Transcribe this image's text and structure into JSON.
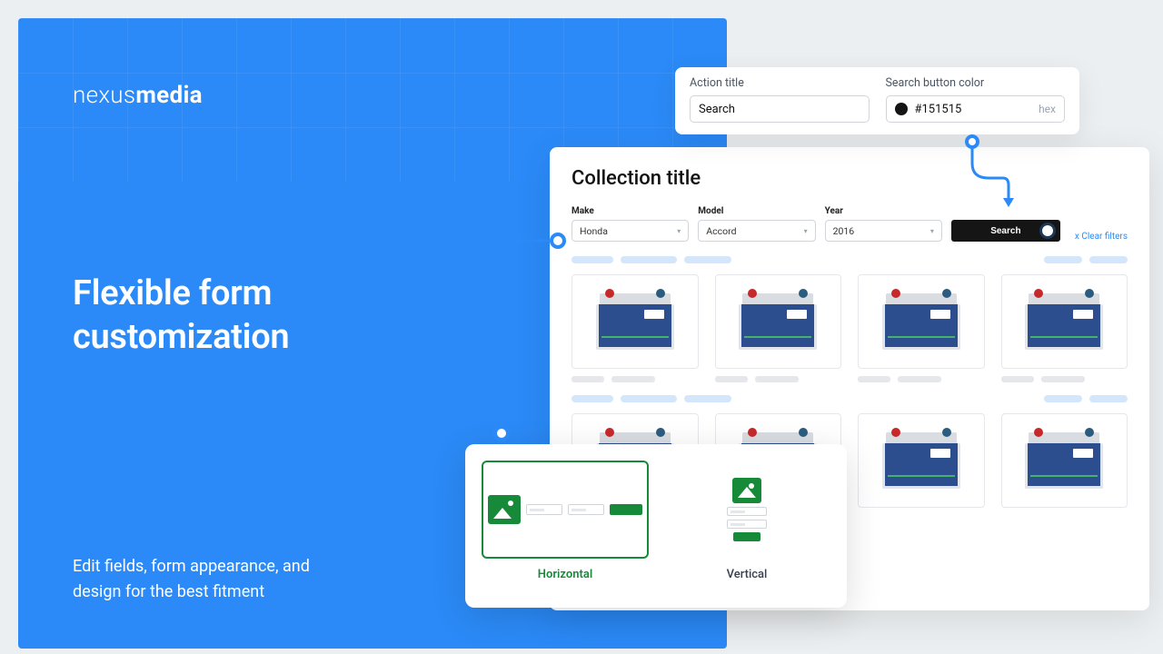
{
  "brand": {
    "part1": "nexus",
    "part2": "media"
  },
  "hero": {
    "headline_l1": "Flexible form",
    "headline_l2": "customization",
    "subcopy": "Edit fields, form appearance, and design for the best fitment"
  },
  "settings": {
    "action_label": "Action title",
    "action_value": "Search",
    "color_label": "Search button color",
    "color_value": "#151515",
    "color_format": "hex"
  },
  "collection": {
    "title": "Collection title",
    "filters": {
      "make_label": "Make",
      "make_value": "Honda",
      "model_label": "Model",
      "model_value": "Accord",
      "year_label": "Year",
      "year_value": "2016"
    },
    "search_button": "Search",
    "clear_link": "x Clear filters"
  },
  "layout_options": {
    "horizontal": "Horizontal",
    "vertical": "Vertical"
  },
  "colors": {
    "brand_blue": "#2b8af7",
    "search_btn": "#151515",
    "accent_green": "#178a3a"
  }
}
